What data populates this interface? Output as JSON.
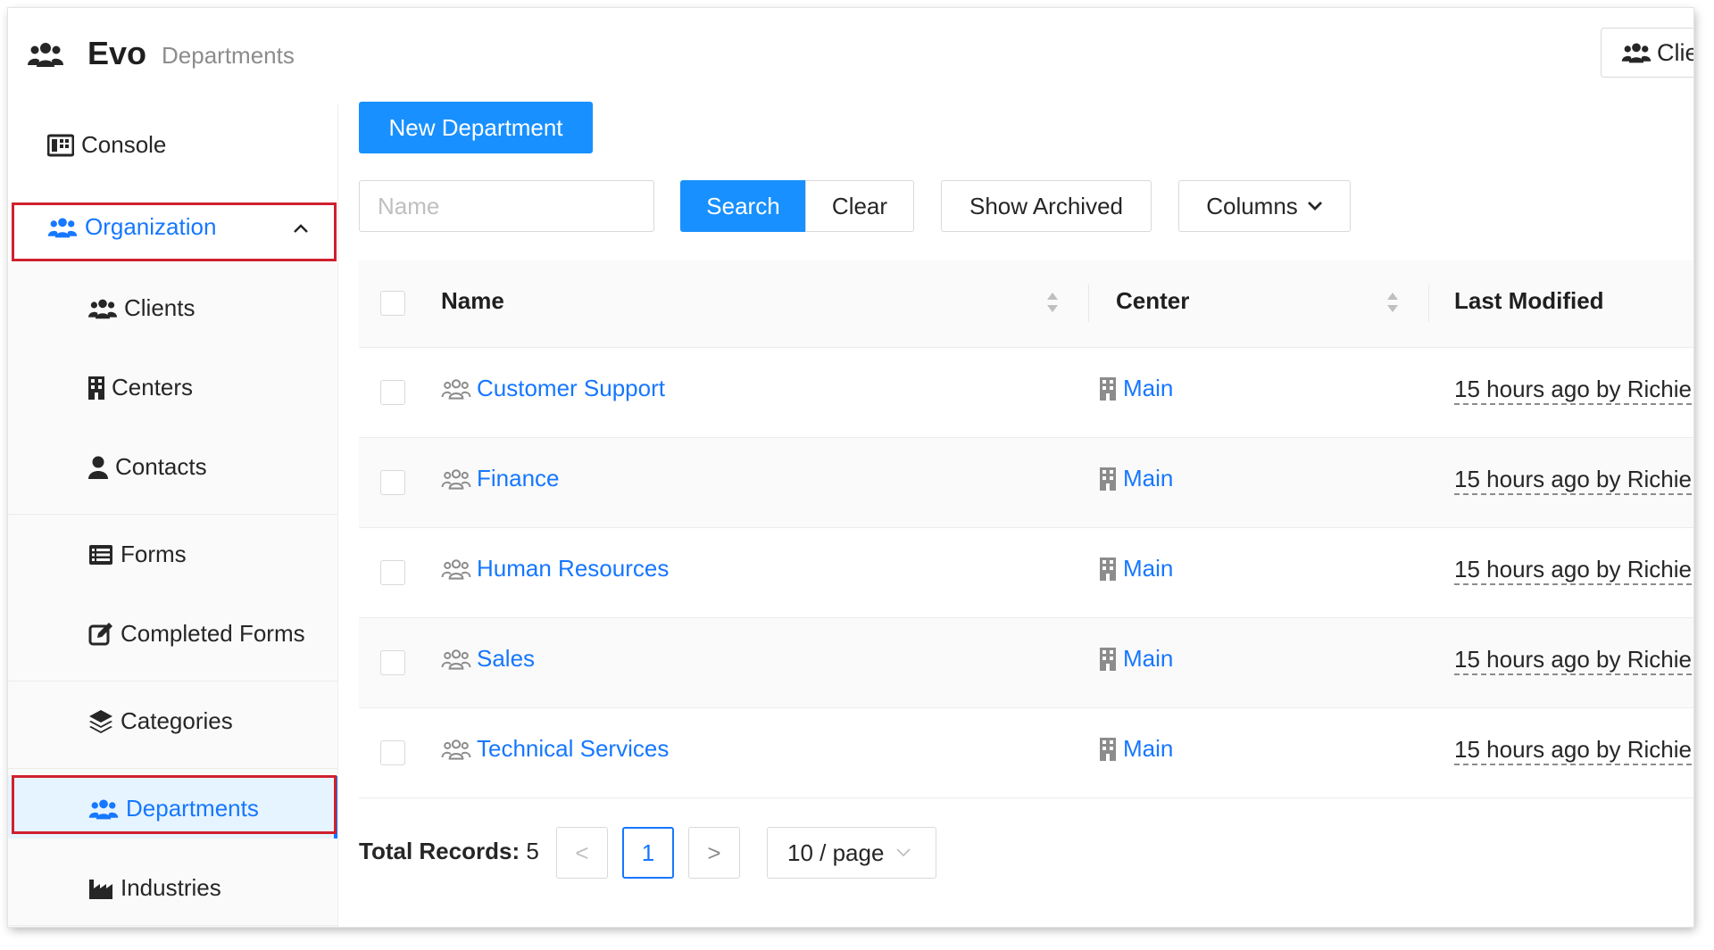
{
  "header": {
    "app_name": "Evo",
    "page_label": "Departments",
    "top_right_button": "Clie"
  },
  "sidebar": {
    "console": "Console",
    "organization": "Organization",
    "clients": "Clients",
    "centers": "Centers",
    "contacts": "Contacts",
    "forms": "Forms",
    "completed_forms": "Completed Forms",
    "categories": "Categories",
    "departments": "Departments",
    "industries": "Industries"
  },
  "toolbar": {
    "new_button": "New Department",
    "search_placeholder": "Name",
    "search_button": "Search",
    "clear_button": "Clear",
    "archived_button": "Show Archived",
    "columns_button": "Columns"
  },
  "table": {
    "headers": [
      "Name",
      "Center",
      "Last Modified"
    ],
    "rows": [
      {
        "name": "Customer Support",
        "center": "Main",
        "modified": "15 hours ago by Richie"
      },
      {
        "name": "Finance",
        "center": "Main",
        "modified": "15 hours ago by Richie"
      },
      {
        "name": "Human Resources",
        "center": "Main",
        "modified": "15 hours ago by Richie"
      },
      {
        "name": "Sales",
        "center": "Main",
        "modified": "15 hours ago by Richie"
      },
      {
        "name": "Technical Services",
        "center": "Main",
        "modified": "15 hours ago by Richie"
      }
    ]
  },
  "pagination": {
    "total_label": "Total Records:",
    "total_value": "5",
    "prev": "<",
    "current_page": "1",
    "next": ">",
    "page_size": "10 / page"
  },
  "colors": {
    "primary": "#1890ff",
    "link": "#1677ff",
    "highlight_border": "#d0202e",
    "active_bg": "#e6f4ff"
  }
}
